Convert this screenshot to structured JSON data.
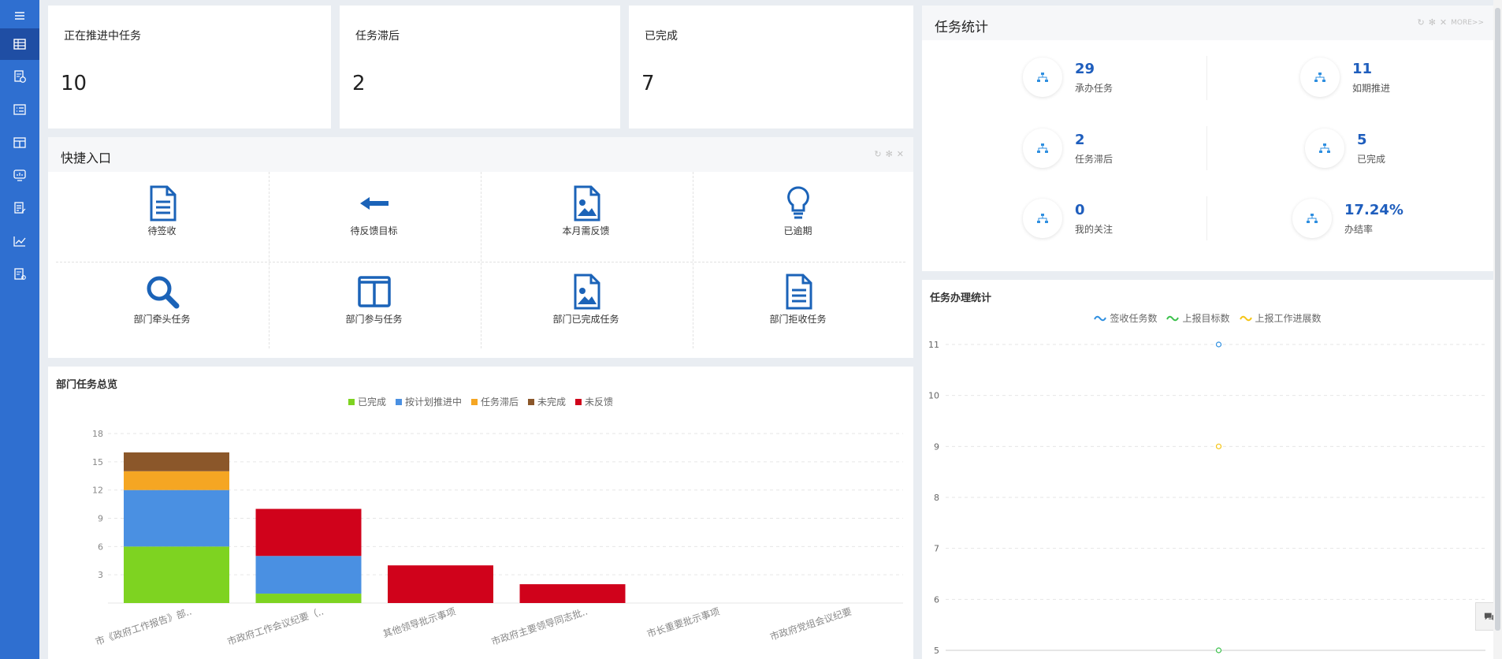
{
  "sidebar": {
    "items": [
      {
        "icon": "menu-icon"
      },
      {
        "icon": "table-icon"
      },
      {
        "icon": "schedule-doc-icon"
      },
      {
        "icon": "checklist-icon"
      },
      {
        "icon": "grid-board-icon"
      },
      {
        "icon": "monitor-icon"
      },
      {
        "icon": "edit-doc-icon"
      },
      {
        "icon": "line-chart-icon"
      },
      {
        "icon": "doc-user-icon"
      }
    ]
  },
  "cards": [
    {
      "label": "正在推进中任务",
      "value": "10"
    },
    {
      "label": "任务滞后",
      "value": "2"
    },
    {
      "label": "已完成",
      "value": "7"
    }
  ],
  "quick": {
    "title": "快捷入口",
    "items": [
      {
        "label": "待签收",
        "icon": "document-icon"
      },
      {
        "label": "待反馈目标",
        "icon": "arrow-left-icon"
      },
      {
        "label": "本月需反馈",
        "icon": "image-doc-icon"
      },
      {
        "label": "已逾期",
        "icon": "lightbulb-icon"
      },
      {
        "label": "部门牵头任务",
        "icon": "search-icon"
      },
      {
        "label": "部门参与任务",
        "icon": "columns-icon"
      },
      {
        "label": "部门已完成任务",
        "icon": "image-doc-icon"
      },
      {
        "label": "部门拒收任务",
        "icon": "document-icon"
      }
    ]
  },
  "task_stats": {
    "title": "任务统计",
    "more": "MORE>>",
    "items": [
      {
        "value": "29",
        "label": "承办任务"
      },
      {
        "value": "11",
        "label": "如期推进"
      },
      {
        "value": "2",
        "label": "任务滞后"
      },
      {
        "value": "5",
        "label": "已完成"
      },
      {
        "value": "0",
        "label": "我的关注"
      },
      {
        "value": "17.24%",
        "label": "办结率"
      }
    ]
  },
  "colors": {
    "sidebar": "#2f6fd0",
    "sidebar_active": "#1f4ea4",
    "accent": "#1f5ebd",
    "done": "#7ed321",
    "on_plan": "#4a90e2",
    "lagging": "#f5a623",
    "unfinished": "#8b572a",
    "no_feedback": "#d0021b",
    "sign": "#2f8fe0",
    "report": "#3cc14c",
    "progress": "#f5c518"
  },
  "chart_data": [
    {
      "type": "bar",
      "stacked": true,
      "title": "部门任务总览",
      "legend_position": "top-center",
      "categories": [
        "市《政府工作报告》部..",
        "市政府工作会议纪要（..",
        "其他领导批示事项",
        "市政府主要领导同志批..",
        "市长重要批示事项",
        "市政府党组会议纪要"
      ],
      "series": [
        {
          "name": "已完成",
          "color": "#7ed321",
          "values": [
            6,
            1,
            0,
            0,
            0,
            0
          ]
        },
        {
          "name": "按计划推进中",
          "color": "#4a90e2",
          "values": [
            6,
            4,
            0,
            0,
            0,
            0
          ]
        },
        {
          "name": "任务滞后",
          "color": "#f5a623",
          "values": [
            2,
            0,
            0,
            0,
            0,
            0
          ]
        },
        {
          "name": "未完成",
          "color": "#8b572a",
          "values": [
            2,
            0,
            0,
            0,
            0,
            0
          ]
        },
        {
          "name": "未反馈",
          "color": "#d0021b",
          "values": [
            0,
            5,
            4,
            2,
            0,
            0
          ]
        }
      ],
      "ylim": [
        0,
        18
      ],
      "yticks": [
        3,
        6,
        9,
        12,
        15,
        18
      ],
      "grid": true
    },
    {
      "type": "line",
      "title": "任务办理统计",
      "legend_position": "top-center",
      "x": [
        ""
      ],
      "series": [
        {
          "name": "签收任务数",
          "color": "#2f8fe0",
          "values": [
            11
          ]
        },
        {
          "name": "上报目标数",
          "color": "#3cc14c",
          "values": [
            5
          ]
        },
        {
          "name": "上报工作进展数",
          "color": "#f5c518",
          "values": [
            9
          ]
        }
      ],
      "ylim": [
        5,
        11
      ],
      "yticks": [
        5,
        6,
        7,
        8,
        9,
        10,
        11
      ],
      "grid": true
    }
  ]
}
